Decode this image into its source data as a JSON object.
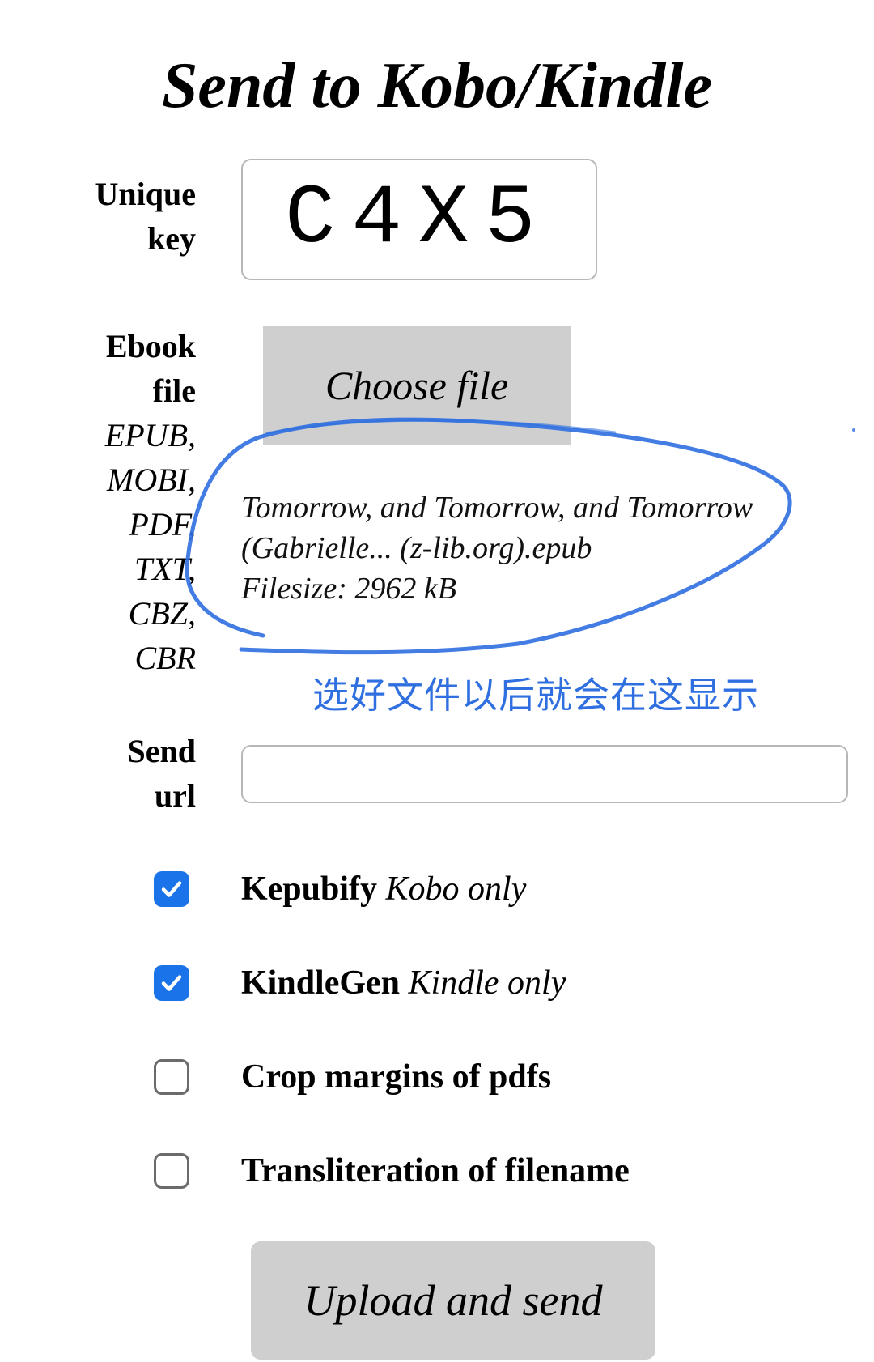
{
  "page": {
    "title": "Send to Kobo/Kindle"
  },
  "form": {
    "unique_key": {
      "label_line1": "Unique",
      "label_line2": "key",
      "value": "C4X5"
    },
    "ebook_file": {
      "label_line1": "Ebook",
      "label_line2": "file",
      "formats": [
        "EPUB,",
        "MOBI,",
        "PDF,",
        "TXT,",
        "CBZ,",
        "CBR"
      ],
      "choose_label": "Choose file",
      "selected_name_line1": "Tomorrow, and Tomorrow, and Tomorrow",
      "selected_name_line2": "(Gabrielle... (z-lib.org).epub",
      "filesize_label": "Filesize: 2962 kB"
    },
    "annotation": {
      "note": "选好文件以后就会在这显示",
      "color": "#2f6fe0"
    },
    "send_url": {
      "label_line1": "Send",
      "label_line2": "url",
      "value": ""
    },
    "options": [
      {
        "label": "Kepubify",
        "note": "Kobo only",
        "checked": true
      },
      {
        "label": "KindleGen",
        "note": "Kindle only",
        "checked": true
      },
      {
        "label": "Crop margins of pdfs",
        "note": "",
        "checked": false
      },
      {
        "label": "Transliteration of filename",
        "note": "",
        "checked": false
      }
    ],
    "submit_label": "Upload and send"
  },
  "colors": {
    "checkbox_checked": "#1a73e8",
    "button_gray": "#cfcfcf",
    "input_border": "#b7b7b7"
  },
  "icons": {
    "checkmark": "check-icon"
  }
}
